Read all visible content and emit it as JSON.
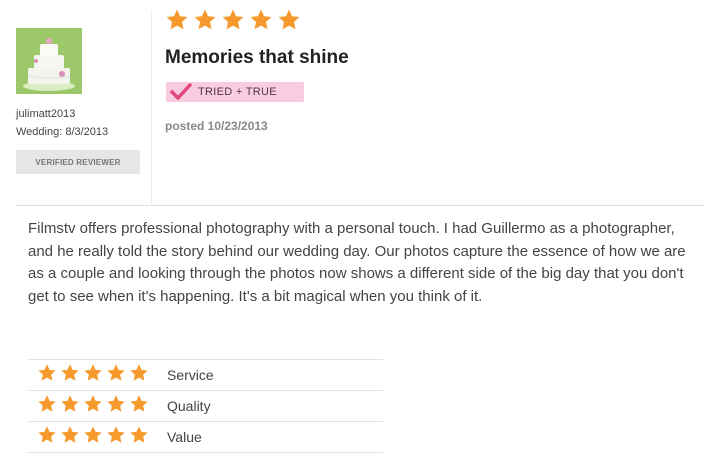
{
  "reviewer": {
    "name": "julimatt2013",
    "wedding": "Wedding: 8/3/2013",
    "verified": "VERIFIED REVIEWER"
  },
  "review": {
    "rating": 5,
    "title": "Memories that shine",
    "badge": "TRIED + TRUE",
    "posted": "posted 10/23/2013",
    "body": "Filmstv offers professional photography with a personal touch. I had Guillermo as a photographer, and he really told the story behind our wedding day. Our photos capture the essence of how we are as a couple and looking through the photos now shows a different side of the big day that you don't get to see when it's happening. It's a bit magical when you think of it."
  },
  "ratings": [
    {
      "label": "Service",
      "stars": 5
    },
    {
      "label": "Quality",
      "stars": 5
    },
    {
      "label": "Value",
      "stars": 5
    }
  ],
  "colors": {
    "star": "#f79a2e",
    "badge_bg": "#f8cde0",
    "check": "#e0457b",
    "avatar_bg": "#9cc86a"
  },
  "icons": {
    "star": "star-icon",
    "check": "check-icon",
    "avatar": "wedding-cake-avatar"
  }
}
